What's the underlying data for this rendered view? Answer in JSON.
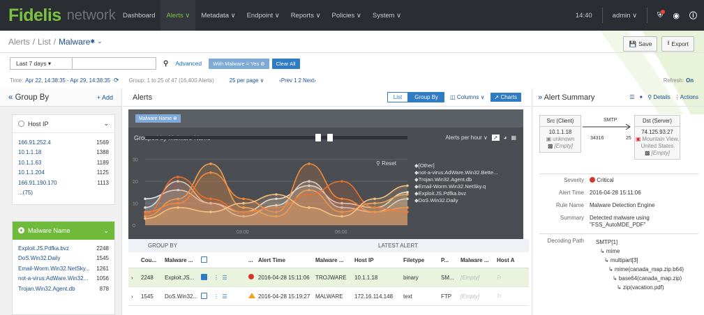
{
  "nav": {
    "logo": "Fidelis",
    "logo_sub": "network",
    "items": [
      "Dashboard",
      "Alerts ∨",
      "Metadata ∨",
      "Endpoint ∨",
      "Reports ∨",
      "Policies ∨",
      "System ∨"
    ],
    "time": "14:40",
    "user": "admin ∨"
  },
  "breadcrumb": {
    "a": "Alerts",
    "b": "List",
    "c": "Malware",
    "star": "✱"
  },
  "actions": {
    "save": "Save",
    "export": "Export"
  },
  "filter": {
    "range": "Last 7 days ▾",
    "advanced": "Advanced",
    "chip": "With Malware = Yes ⊗",
    "clear": "Clear All"
  },
  "info": {
    "time_prefix": "Time:",
    "time_value": "Apr 22, 14:38:35 - Apr 29, 14:38:35",
    "group_text": "Group: 1 to 25 of 47 (16,400 Alerts)",
    "per_page": "25 per page ∨",
    "pager": "‹Prev  1  2  Next›",
    "refresh_label": "Refresh:",
    "refresh_value": "On"
  },
  "groupby": {
    "title": "Group By",
    "add": "+ Add",
    "host_facet": "Host IP",
    "hosts": [
      {
        "name": "166.91.252.4",
        "count": "1569"
      },
      {
        "name": "10.1.1.18",
        "count": "1388"
      },
      {
        "name": "10.1.1.63",
        "count": "1189"
      },
      {
        "name": "10.1.1.204",
        "count": "1125"
      },
      {
        "name": "166.91.190.170",
        "count": "1113"
      },
      {
        "name": "...(75)",
        "count": ""
      }
    ],
    "malware_facet": "Malware Name",
    "malwares": [
      {
        "name": "Exploit.JS.Pdfka.bvz",
        "count": "2248"
      },
      {
        "name": "DoS.Win32.Daily",
        "count": "1545"
      },
      {
        "name": "Email-Worm.Win32.NetSky...",
        "count": "1261"
      },
      {
        "name": "not-a-virus:AdWare.Win32...",
        "count": "1056"
      },
      {
        "name": "Trojan.Win32.Agent.db",
        "count": "878"
      }
    ]
  },
  "alerts": {
    "title": "Alerts",
    "view_list": "List",
    "view_group": "Group By",
    "columns": "Columns ∨",
    "charts": "Charts"
  },
  "chart": {
    "chip": "Malware Name ⊗",
    "title": "Grouped by Malware Name",
    "interval": "Alerts per hour ∨",
    "reset": "Reset",
    "ticks": [
      "30",
      "20",
      "10",
      "0"
    ],
    "xticks": [
      "03:00",
      "06:00"
    ],
    "legend": [
      "[Other]",
      "not-a-virus:AdWare.Win32.Bette...",
      "Trojan.Win32.Agent.db",
      "Email-Worm.Win32.NetSky.q",
      "Exploit.JS.Pdfka.bvz",
      "DoS.Win32.Daily"
    ]
  },
  "chart_data": {
    "type": "area",
    "x": [
      "00:00",
      "01:00",
      "02:00",
      "03:00",
      "04:00",
      "05:00",
      "06:00",
      "07:00",
      "08:00"
    ],
    "series": [
      {
        "name": "[Other]",
        "values": [
          12,
          16,
          10,
          6,
          12,
          18,
          10,
          8,
          15
        ]
      },
      {
        "name": "not-a-virus:AdWare.Win32.Bette...",
        "values": [
          8,
          20,
          10,
          4,
          9,
          20,
          8,
          6,
          12
        ]
      },
      {
        "name": "Trojan.Win32.Agent.db",
        "values": [
          4,
          12,
          28,
          8,
          4,
          16,
          6,
          10,
          14
        ]
      },
      {
        "name": "Email-Worm.Win32.NetSky.q",
        "values": [
          6,
          10,
          24,
          12,
          6,
          28,
          12,
          6,
          8
        ]
      },
      {
        "name": "Exploit.JS.Pdfka.bvz",
        "values": [
          5,
          22,
          12,
          6,
          8,
          14,
          20,
          8,
          6
        ]
      },
      {
        "name": "DoS.Win32.Daily",
        "values": [
          3,
          8,
          6,
          10,
          14,
          8,
          4,
          12,
          18
        ]
      }
    ],
    "ylim": [
      0,
      35
    ],
    "grid": true,
    "legend": "right",
    "colors": [
      "#e0e0e0",
      "#d8d8d8",
      "#f0a050",
      "#f28a3c",
      "#e87030",
      "#f5c080"
    ]
  },
  "table": {
    "group_label": "GROUP BY",
    "latest_label": "LATEST ALERT",
    "headers": [
      "Cou...",
      "Malware ...",
      "",
      "",
      "...",
      "Alert Time",
      "Malware ...",
      "Host IP",
      "Filetype",
      "P...",
      "Malware ...",
      "Host A"
    ],
    "rows": [
      {
        "count": "2248",
        "name": "Exploit.JS...",
        "time": "2016-04-28 15:11:06",
        "malware": "TROJWARE",
        "host": "10.1.1.18",
        "filetype": "binary",
        "p": "SM...",
        "m2": "[Empty]"
      },
      {
        "count": "1545",
        "name": "DoS.Win32...",
        "time": "2016-04-28 15:19:27",
        "malware": "MALWARE",
        "host": "172.16.114.148",
        "filetype": "text",
        "p": "FTP",
        "m2": "[Empty]"
      }
    ]
  },
  "summary": {
    "title": "Alert Summary",
    "details": "Details",
    "actions": "Actions",
    "src_label": "Src (Client)",
    "src_ip": "10.1.1.18",
    "src_loc": "unknown",
    "src_empty": "[Empty]",
    "proto": "SMTP",
    "src_port": "34316",
    "dst_port": "25",
    "dst_label": "Dst (Server)",
    "dst_ip": "74.125.93.27",
    "dst_loc1": "Mountain View,",
    "dst_loc2": "United States",
    "dst_empty": "[Empty]",
    "severity_k": "Severity",
    "severity_v": "Critical",
    "time_k": "Alert Time",
    "time_v": "2016-04-28 15:11:06",
    "rule_k": "Rule Name",
    "rule_v": "Malware Detection Engine",
    "summary_k": "Summary",
    "summary_v": "Detected malware using \"FSS_AutoMDE_PDF\"",
    "path_k": "Decoding Path",
    "path": [
      "SMTP[1]",
      "↳ mime",
      "↳ multipart[3]",
      "↳ mime(canada_map.zip.b64)",
      "↳ base64(canada_map.zip)",
      "↳ zip(vacation.pdf)"
    ]
  }
}
